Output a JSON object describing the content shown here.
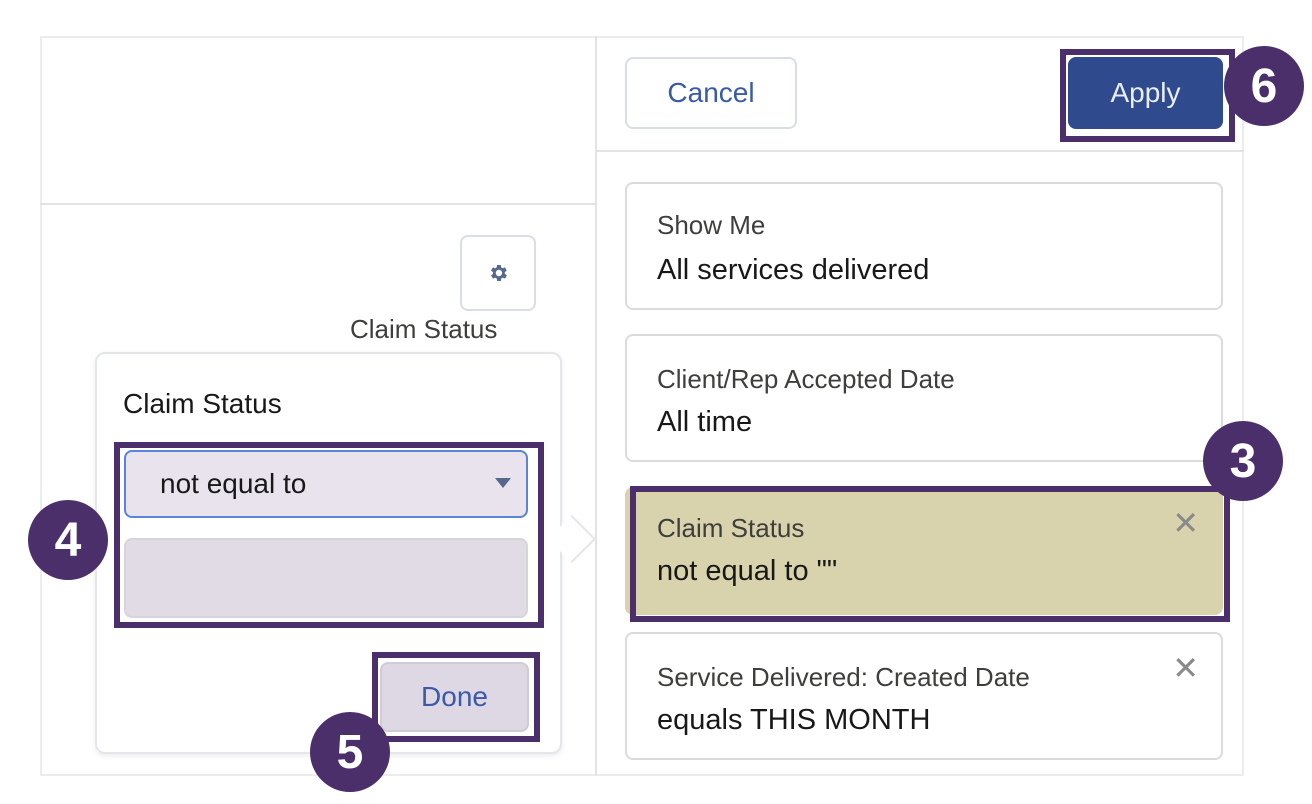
{
  "header": {
    "cancel_label": "Cancel",
    "apply_label": "Apply"
  },
  "left_panel": {
    "column_label": "Claim Status",
    "gear_icon": "gear-icon"
  },
  "popover": {
    "title": "Claim Status",
    "operator_value": "not equal to",
    "value_field": "",
    "done_label": "Done"
  },
  "filters": [
    {
      "label": "Show Me",
      "value": "All services delivered",
      "removable": false
    },
    {
      "label": "Client/Rep Accepted Date",
      "value": "All time",
      "removable": false
    },
    {
      "label": "Claim Status",
      "value": "not equal to \"\"",
      "removable": true
    },
    {
      "label": "Service Delivered: Created Date",
      "value": "equals THIS MONTH",
      "removable": true
    }
  ],
  "annotations": {
    "step3": "3",
    "step4": "4",
    "step5": "5",
    "step6": "6",
    "highlight_color": "#4a2f6b"
  },
  "colors": {
    "apply_bg": "#2f4b8e",
    "selected_filter_bg": "#d8d3ad",
    "link_blue": "#3a5aa8"
  }
}
